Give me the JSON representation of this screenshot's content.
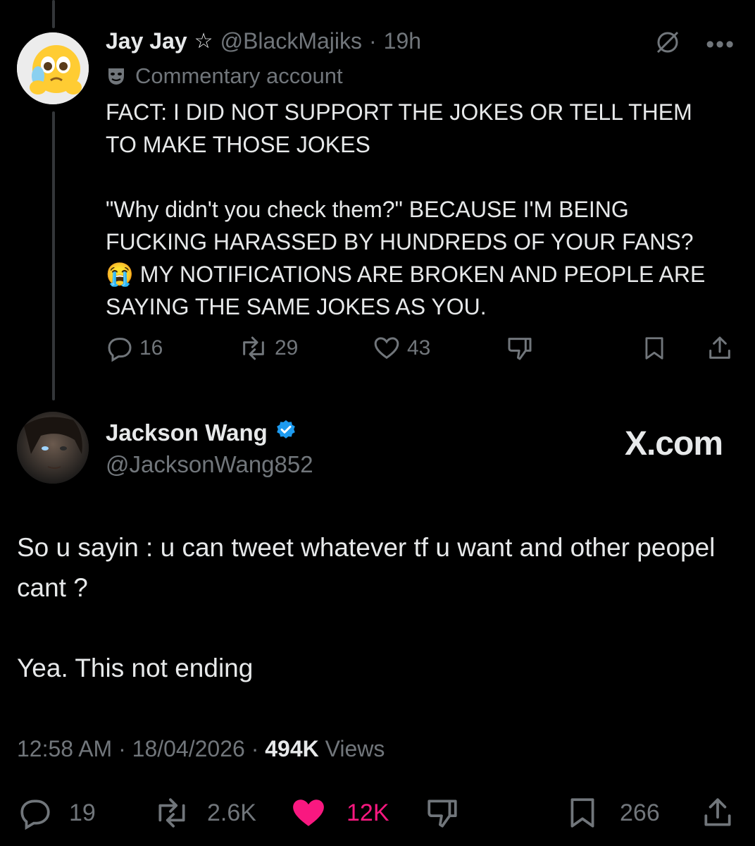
{
  "reply": {
    "display_name": "Jay Jay",
    "handle": "@BlackMajiks",
    "separator": "·",
    "time": "19h",
    "label": "Commentary account",
    "lines": [
      "FACT: I DID NOT SUPPORT THE JOKES OR TELL THEM TO MAKE THOSE JOKES",
      "\"Why didn't you check them?\" BECAUSE I'M BEING FUCKING HARASSED BY HUNDREDS OF YOUR FANS? 😭 MY NOTIFICATIONS ARE BROKEN AND PEOPLE ARE SAYING THE SAME JOKES AS YOU."
    ],
    "stats": {
      "replies": "16",
      "reposts": "29",
      "likes": "43"
    }
  },
  "main": {
    "display_name": "Jackson Wang",
    "handle": "@JacksonWang852",
    "brand": "X.com",
    "lines": [
      "So u sayin : u can tweet whatever tf u want and other peopel cant ?",
      "Yea. This not ending"
    ],
    "time": "12:58 AM",
    "date": "18/04/2026",
    "separator": "·",
    "views_count": "494K",
    "views_label": "Views",
    "stats": {
      "replies": "19",
      "reposts": "2.6K",
      "likes": "12K",
      "bookmarks": "266"
    }
  },
  "colors": {
    "background": "#000000",
    "text": "#e7e9ea",
    "muted": "#71767b",
    "like_active": "#f91880",
    "verified": "#1d9bf0"
  },
  "icons": [
    "star-icon",
    "mask-icon",
    "no-grok-icon",
    "more-icon",
    "reply-icon",
    "repost-icon",
    "like-icon",
    "dislike-icon",
    "bookmark-icon",
    "share-icon",
    "verified-badge-icon"
  ]
}
